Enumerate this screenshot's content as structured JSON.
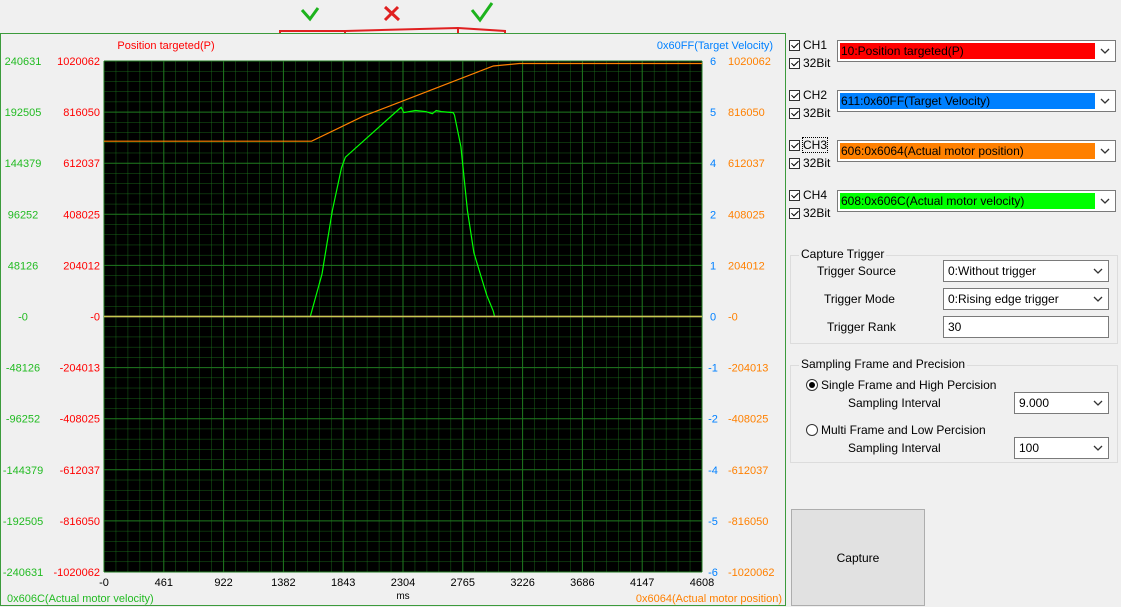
{
  "annotations": {
    "mark1": "✓",
    "mark2": "✗",
    "mark3": "✓"
  },
  "scope": {
    "ch1_label": "Position targeted(P)",
    "ch2_label": "0x60FF(Target Velocity)",
    "ch4_label": "0x606C(Actual motor velocity)",
    "ch3_label": "0x6064(Actual motor position)",
    "x_unit": "ms",
    "x_ticks": [
      "-0",
      "461",
      "922",
      "1382",
      "1843",
      "2304",
      "2765",
      "3226",
      "3686",
      "4147",
      "4608"
    ],
    "left_outer_ticks": [
      "240631",
      "192505",
      "144379",
      "96252",
      "48126",
      "-0",
      "-48126",
      "-96252",
      "-144379",
      "-192505",
      "-240631"
    ],
    "left_inner_ticks": [
      "1020062",
      "816050",
      "612037",
      "408025",
      "204012",
      "-0",
      "-204013",
      "-408025",
      "-612037",
      "-816050",
      "-1020062"
    ],
    "right_inner_ticks": [
      "6",
      "5",
      "4",
      "2",
      "1",
      "0",
      "-1",
      "-2",
      "-4",
      "-5",
      "-6"
    ],
    "right_outer_ticks": [
      "1020062",
      "816050",
      "612037",
      "408025",
      "204012",
      "-0",
      "-204013",
      "-408025",
      "-612037",
      "-816050",
      "-1020062"
    ],
    "colors": {
      "ch1": "#ff0000",
      "ch2": "#0080ff",
      "ch3": "#ff8000",
      "ch4": "#00ff00",
      "grid": "#1f7a1f",
      "plot_bg": "#000000"
    }
  },
  "chart_data": {
    "type": "line",
    "x_unit": "ms",
    "xlim": [
      0,
      4608
    ],
    "series": [
      {
        "name": "0x6064(Actual motor position)",
        "axis": "right_outer",
        "x": [
          0,
          1600,
          2000,
          2500,
          3000,
          3200,
          4608
        ],
        "y": [
          700000,
          700000,
          800000,
          900000,
          1000000,
          1010000,
          1010000
        ]
      },
      {
        "name": "0x606C(Actual motor velocity)",
        "axis": "left_outer",
        "x": [
          0,
          1590,
          1680,
          1760,
          1830,
          1860,
          2270,
          2290,
          2310,
          2400,
          2480,
          2530,
          2560,
          2600,
          2690,
          2700,
          2750,
          2800,
          2850,
          2900,
          2950,
          3000,
          3010,
          3080,
          3100,
          3106,
          4608
        ],
        "y": [
          0,
          0,
          40000,
          100000,
          140000,
          150000,
          195000,
          197000,
          192000,
          194000,
          193000,
          191000,
          194000,
          193000,
          192000,
          190000,
          160000,
          100000,
          60000,
          40000,
          20000,
          5000,
          0,
          0,
          0,
          0,
          0
        ]
      },
      {
        "name": "Position targeted(P)",
        "axis": "left_inner",
        "x": [
          0,
          4608
        ],
        "y": [
          0,
          0
        ]
      },
      {
        "name": "0x60FF(Target Velocity)",
        "axis": "right_inner",
        "x": [
          0,
          4608
        ],
        "y": [
          0,
          0
        ]
      }
    ]
  },
  "panel": {
    "channels": [
      {
        "cb_label": "CH1",
        "bit_label": "32Bit",
        "value": "10:Position targeted(P)",
        "color": "#ff0000"
      },
      {
        "cb_label": "CH2",
        "bit_label": "32Bit",
        "value": "611:0x60FF(Target Velocity)",
        "color": "#0080ff"
      },
      {
        "cb_label": "CH3",
        "bit_label": "32Bit",
        "value": "606:0x6064(Actual motor position)",
        "color": "#ff8000"
      },
      {
        "cb_label": "CH4",
        "bit_label": "32Bit",
        "value": "608:0x606C(Actual motor velocity)",
        "color": "#00ff00"
      }
    ],
    "trigger": {
      "title": "Capture Trigger",
      "source_label": "Trigger Source",
      "source_value": "0:Without trigger",
      "mode_label": "Trigger Mode",
      "mode_value": "0:Rising edge trigger",
      "rank_label": "Trigger Rank",
      "rank_value": "30"
    },
    "sampling": {
      "title": "Sampling Frame and Precision",
      "opt1_label": "Single Frame and High Percision",
      "interval1_label": "Sampling Interval",
      "interval1_value": "9.000",
      "opt2_label": "Multi Frame and Low Percision",
      "interval2_label": "Sampling Interval",
      "interval2_value": "100"
    },
    "capture_label": "Capture"
  }
}
